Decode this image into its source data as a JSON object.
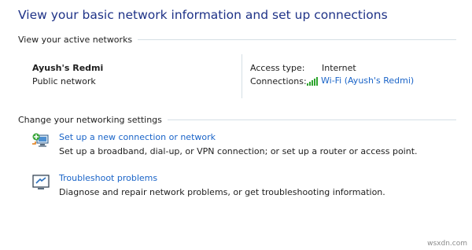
{
  "page": {
    "title": "View your basic network information and set up connections"
  },
  "active_networks": {
    "heading": "View your active networks",
    "network_name": "Ayush's Redmi",
    "network_type": "Public network",
    "access_type_label": "Access type:",
    "access_type_value": "Internet",
    "connections_label": "Connections:",
    "connection_link": "Wi-Fi (Ayush's Redmi)",
    "signal_icon": "wifi-signal-bars-icon"
  },
  "networking_settings": {
    "heading": "Change your networking settings",
    "tasks": [
      {
        "icon": "new-connection-icon",
        "link": "Set up a new connection or network",
        "description": "Set up a broadband, dial-up, or VPN connection; or set up a router or access point."
      },
      {
        "icon": "troubleshoot-icon",
        "link": "Troubleshoot problems",
        "description": "Diagnose and repair network problems, or get troubleshooting information."
      }
    ]
  },
  "watermark": "wsxdn.com",
  "colors": {
    "title": "#1e3287",
    "link": "#1a64c8",
    "signal": "#2ea52e",
    "divider": "#d5dfe5"
  }
}
